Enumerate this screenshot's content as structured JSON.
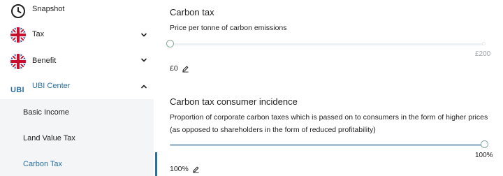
{
  "sidebar": {
    "items": [
      {
        "label": "Snapshot",
        "icon": "clock-icon"
      },
      {
        "label": "Tax",
        "icon": "uk-flag-icon"
      },
      {
        "label": "Benefit",
        "icon": "uk-flag-icon"
      },
      {
        "label": "UBI Center",
        "badge": "UBI"
      }
    ],
    "sub_items": [
      {
        "label": "Basic Income"
      },
      {
        "label": "Land Value Tax"
      },
      {
        "label": "Carbon Tax"
      }
    ],
    "accent_color": "#2c6f9b"
  },
  "main": {
    "params": [
      {
        "title": "Carbon tax",
        "description": "Price per tonne of carbon emissions",
        "slider_max_label": "£200",
        "slider_fraction": 0.0,
        "value": "£0"
      },
      {
        "title": "Carbon tax consumer incidence",
        "description": "Proportion of corporate carbon taxes which is passed on to consumers in the form of higher prices (as opposed to shareholders in the form of reduced profitability)",
        "slider_max_label": "100%",
        "slider_fraction": 1.0,
        "value": "100%"
      }
    ]
  }
}
